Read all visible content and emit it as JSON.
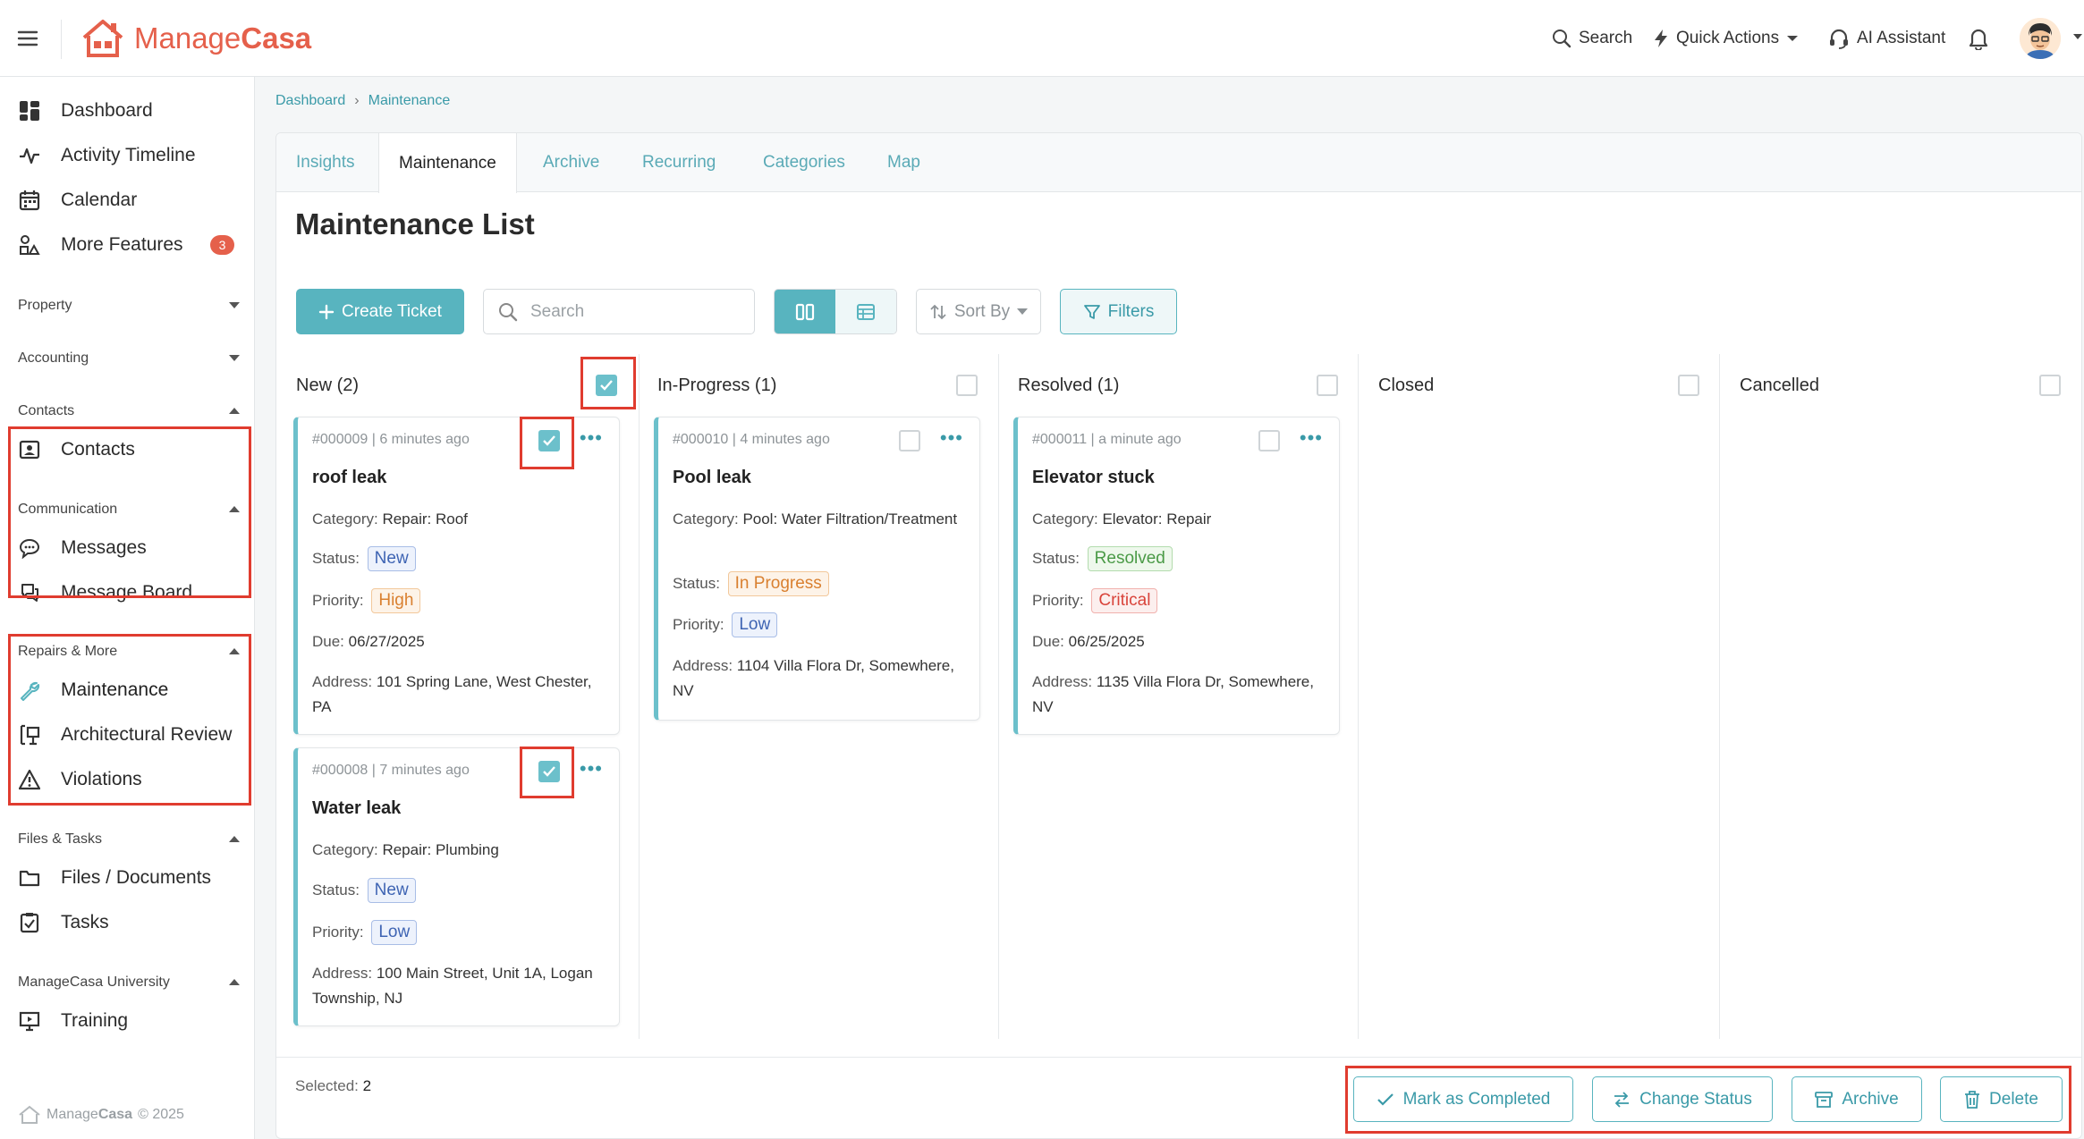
{
  "brand": {
    "name_part1": "Manage",
    "name_part2": "Casa"
  },
  "topbar": {
    "search_label": "Search",
    "quick_actions_label": "Quick Actions",
    "ai_assistant_label": "AI Assistant"
  },
  "sidebar": {
    "dashboard": "Dashboard",
    "activity_timeline": "Activity Timeline",
    "calendar": "Calendar",
    "more_features": "More Features",
    "more_features_badge": "3",
    "sec_property": "Property",
    "sec_accounting": "Accounting",
    "sec_contacts": "Contacts",
    "contacts": "Contacts",
    "sec_communication": "Communication",
    "messages": "Messages",
    "message_board": "Message Board",
    "sec_repairs": "Repairs & More",
    "maintenance": "Maintenance",
    "architectural_review": "Architectural Review",
    "violations": "Violations",
    "sec_files": "Files & Tasks",
    "files_documents": "Files / Documents",
    "tasks": "Tasks",
    "sec_university": "ManageCasa University",
    "training": "Training",
    "footer_copyright": "© 2025"
  },
  "breadcrumb": {
    "home": "Dashboard",
    "sep": "›",
    "current": "Maintenance"
  },
  "tabs": [
    "Insights",
    "Maintenance",
    "Archive",
    "Recurring",
    "Categories",
    "Map"
  ],
  "page": {
    "title": "Maintenance List",
    "create_ticket": "Create Ticket",
    "search_placeholder": "Search",
    "sort_by": "Sort By",
    "filters": "Filters"
  },
  "columns": [
    {
      "label": "New (2)",
      "checked": true
    },
    {
      "label": "In-Progress (1)",
      "checked": false
    },
    {
      "label": "Resolved (1)",
      "checked": false
    },
    {
      "label": "Closed",
      "checked": false
    },
    {
      "label": "Cancelled",
      "checked": false
    }
  ],
  "labels": {
    "category": "Category:",
    "status": "Status:",
    "priority": "Priority:",
    "due": "Due:",
    "address": "Address:"
  },
  "cards": [
    {
      "meta": "#000009 | 6 minutes ago",
      "title": "roof leak",
      "category": "Repair: Roof",
      "status": "New",
      "priority": "High",
      "due": "06/27/2025",
      "address": "101 Spring Lane, West Chester, PA",
      "checked": true
    },
    {
      "meta": "#000008 | 7 minutes ago",
      "title": "Water leak",
      "category": "Repair: Plumbing",
      "status": "New",
      "priority": "Low",
      "address": "100 Main Street, Unit 1A, Logan Township, NJ",
      "checked": true
    },
    {
      "meta": "#000010 | 4 minutes ago",
      "title": "Pool leak",
      "category": "Pool: Water Filtration/Treatment",
      "status": "In Progress",
      "priority": "Low",
      "address": "1104 Villa Flora Dr, Somewhere, NV",
      "checked": false
    },
    {
      "meta": "#000011 | a minute ago",
      "title": "Elevator stuck",
      "category": "Elevator: Repair",
      "status": "Resolved",
      "priority": "Critical",
      "due": "06/25/2025",
      "address": "1135 Villa Flora Dr, Somewhere, NV",
      "checked": false
    }
  ],
  "bottom": {
    "selected_label": "Selected:",
    "selected_count": "2",
    "mark_completed": "Mark as Completed",
    "change_status": "Change Status",
    "archive": "Archive",
    "delete": "Delete"
  },
  "colors": {
    "brand": "#e5604b",
    "accent": "#58b4bf",
    "highlight": "#e03c2f"
  }
}
